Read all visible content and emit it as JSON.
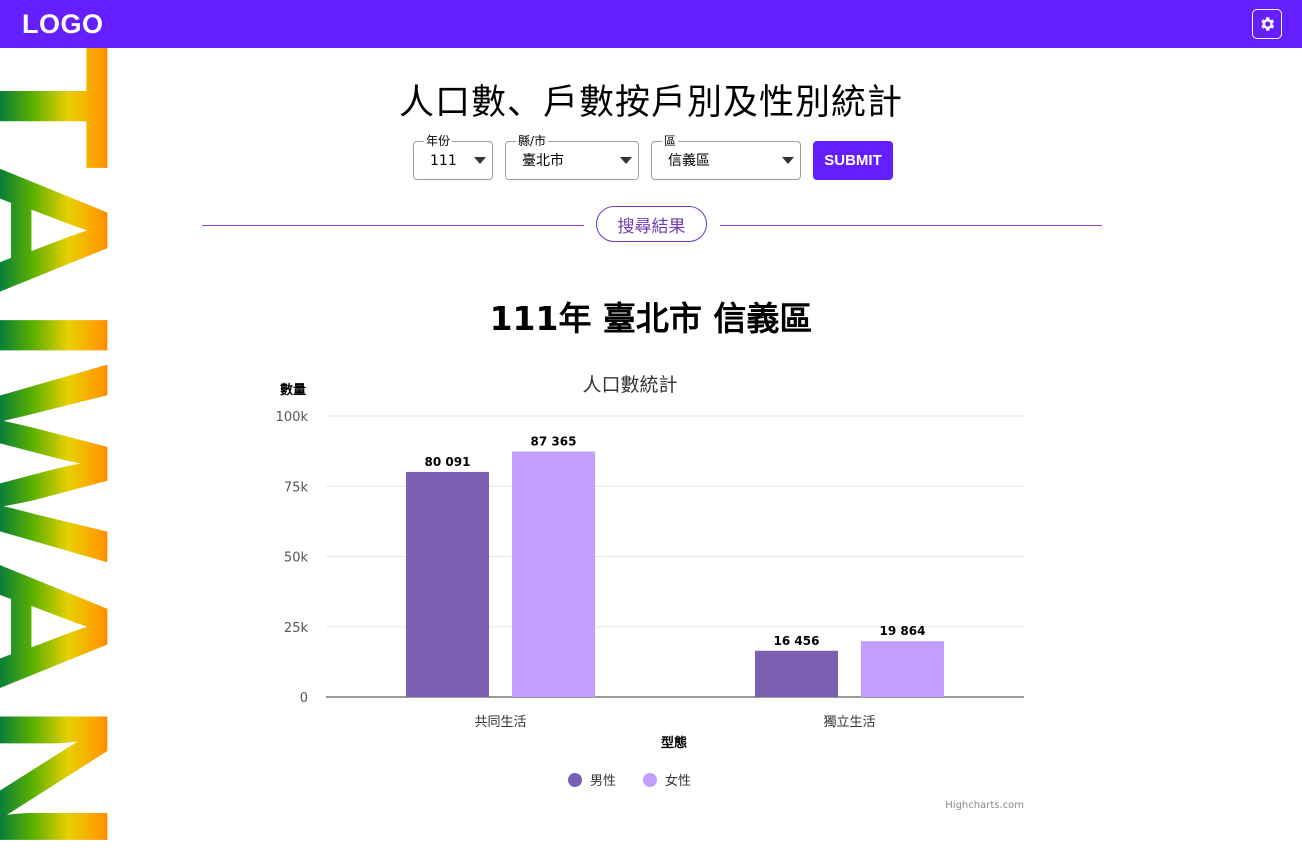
{
  "header": {
    "logo": "LOGO",
    "settings_icon": "gear-icon"
  },
  "sidebar_art": {
    "text": "TAIWAN"
  },
  "page": {
    "title": "人口數、戶數按戶別及性別統計"
  },
  "filters": {
    "year": {
      "legend": "年份",
      "value": "111"
    },
    "county": {
      "legend": "縣/市",
      "value": "臺北市"
    },
    "district": {
      "legend": "區",
      "value": "信義區"
    },
    "submit_label": "SUBMIT"
  },
  "divider": {
    "label": "搜尋結果"
  },
  "result": {
    "heading": "111年 臺北市 信義區"
  },
  "colors": {
    "brand": "#651fff",
    "male": "#7c5fb0",
    "female": "#c29fff"
  },
  "chart_data": {
    "type": "bar",
    "title": "人口數統計",
    "ylabel": "數量",
    "xlabel": "型態",
    "categories": [
      "共同生活",
      "獨立生活"
    ],
    "series": [
      {
        "name": "男性",
        "values": [
          80091,
          16456
        ],
        "labels": [
          "80 091",
          "16 456"
        ]
      },
      {
        "name": "女性",
        "values": [
          87365,
          19864
        ],
        "labels": [
          "87 365",
          "19 864"
        ]
      }
    ],
    "ylim": [
      0,
      100000
    ],
    "yticks": [
      "0",
      "25k",
      "50k",
      "75k",
      "100k"
    ],
    "grid": true,
    "legend": "bottom-center",
    "credits": "Highcharts.com"
  }
}
